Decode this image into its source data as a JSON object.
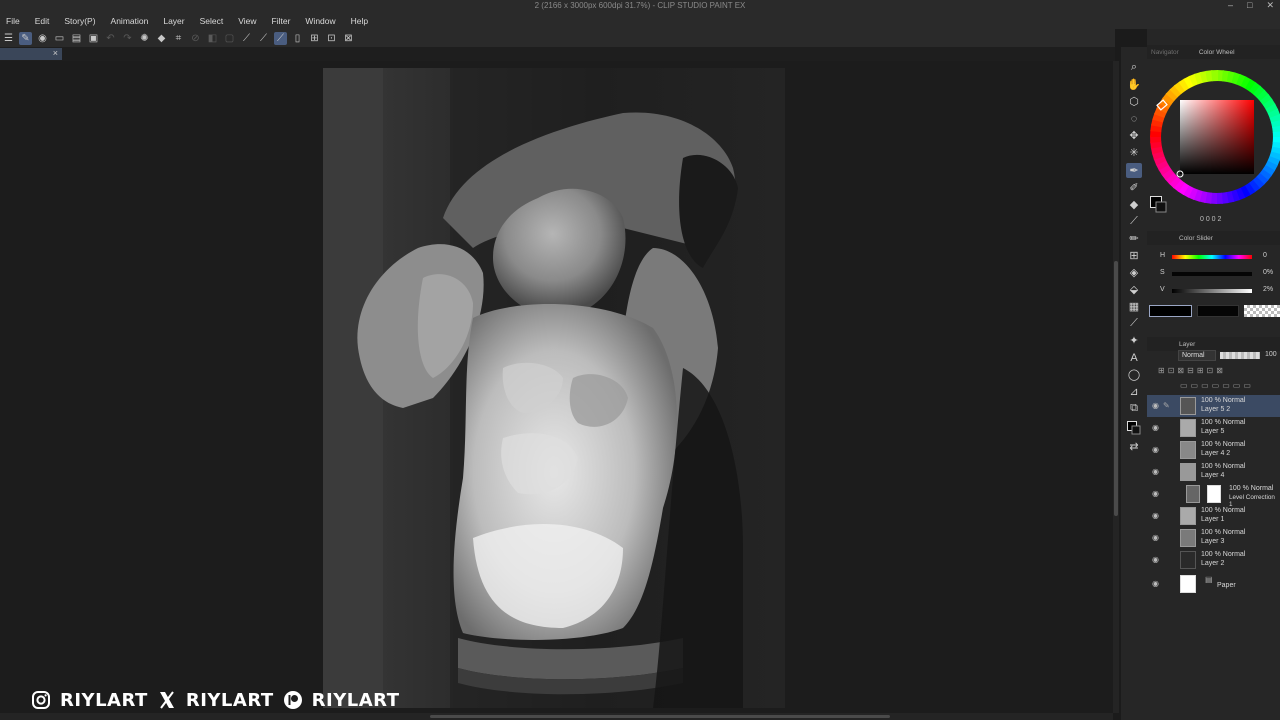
{
  "window": {
    "title": "2 (2166 x 3000px 600dpi 31.7%) - CLIP STUDIO PAINT EX",
    "controls": [
      "–",
      "□",
      "✕"
    ]
  },
  "menu": [
    "File",
    "Edit",
    "Story(P)",
    "Animation",
    "Layer",
    "Select",
    "View",
    "Filter",
    "Window",
    "Help"
  ],
  "colors": {
    "accent": "#4a5d80",
    "selected_layer": "#3b4a63",
    "panel_bg": "#262626",
    "canvas_bg": "#1c1c1c"
  },
  "canvas_tab": {
    "close": "×"
  },
  "panels": {
    "top_tabs": {
      "navigator": "Navigator",
      "color_wheel": "Color Wheel"
    },
    "color_wheel_readout": "0 0 0 2",
    "color_slider": {
      "title": "Color Slider",
      "rows": [
        {
          "label": "H",
          "value": "0"
        },
        {
          "label": "S",
          "value": "0%"
        },
        {
          "label": "V",
          "value": "2%"
        }
      ]
    },
    "layer": {
      "title": "Layer",
      "blend_mode": "Normal",
      "opacity": "100",
      "items": [
        {
          "mode": "100 % Normal",
          "name": "Layer 5 2",
          "selected": true
        },
        {
          "mode": "100 % Normal",
          "name": "Layer 5",
          "selected": false
        },
        {
          "mode": "100 % Normal",
          "name": "Layer 4 2",
          "selected": false
        },
        {
          "mode": "100 % Normal",
          "name": "Layer 4",
          "selected": false
        },
        {
          "mode": "100 % Normal",
          "name": "Level Correction 1",
          "selected": false,
          "correction": true
        },
        {
          "mode": "100 % Normal",
          "name": "Layer 1",
          "selected": false
        },
        {
          "mode": "100 % Normal",
          "name": "Layer 3",
          "selected": false
        },
        {
          "mode": "100 % Normal",
          "name": "Layer 2",
          "selected": false
        },
        {
          "mode": "",
          "name": "Paper",
          "selected": false,
          "paper": true
        }
      ]
    }
  },
  "watermark": {
    "instagram": "RIYLART",
    "x": "RIYLART",
    "patreon": "RIYLART"
  }
}
